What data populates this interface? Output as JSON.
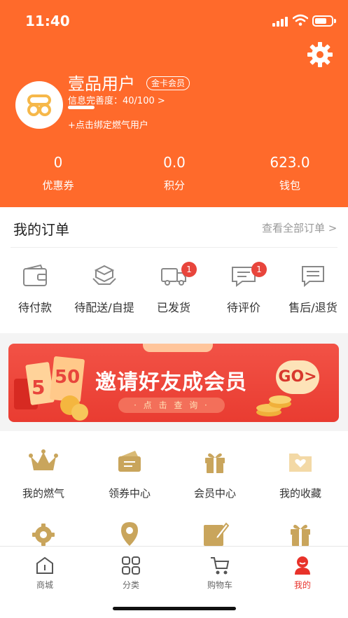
{
  "status_bar": {
    "time": "11:40"
  },
  "profile": {
    "name": "壹品用户",
    "badge": "金卡会员",
    "info_completeness": "信息完善度：40/100 >",
    "info_progress": 0.4,
    "bind_gas_link": "+点击绑定燃气用户"
  },
  "stats": [
    {
      "value": "0",
      "label": "优惠券"
    },
    {
      "value": "0.0",
      "label": "积分"
    },
    {
      "value": "623.0",
      "label": "钱包"
    }
  ],
  "orders": {
    "title": "我的订单",
    "view_all": "查看全部订单 >",
    "items": [
      {
        "label": "待付款",
        "icon": "wallet-icon",
        "badge": ""
      },
      {
        "label": "待配送/自提",
        "icon": "package-icon",
        "badge": ""
      },
      {
        "label": "已发货",
        "icon": "truck-icon",
        "badge": "1"
      },
      {
        "label": "待评价",
        "icon": "comment-icon",
        "badge": "1"
      },
      {
        "label": "售后/退货",
        "icon": "message-icon",
        "badge": ""
      }
    ]
  },
  "banner": {
    "title": "邀请好友成会员",
    "cta": "· 点 击 查 询 ·",
    "go": "GO>"
  },
  "features": [
    {
      "label": "我的燃气",
      "icon": "crown-icon"
    },
    {
      "label": "领券中心",
      "icon": "coupon-icon"
    },
    {
      "label": "会员中心",
      "icon": "gift-icon"
    },
    {
      "label": "我的收藏",
      "icon": "folder-heart-icon"
    },
    {
      "label": "",
      "icon": "gear-icon"
    },
    {
      "label": "",
      "icon": "location-pin-icon"
    },
    {
      "label": "",
      "icon": "edit-note-icon"
    },
    {
      "label": "",
      "icon": "gift-box-icon"
    }
  ],
  "tabbar": [
    {
      "label": "商城",
      "icon": "home-icon"
    },
    {
      "label": "分类",
      "icon": "grid-icon"
    },
    {
      "label": "购物车",
      "icon": "cart-icon"
    },
    {
      "label": "我的",
      "icon": "user-icon",
      "active": true
    }
  ],
  "colors": {
    "brand": "#ff6a2b",
    "badge_red": "#e8453c",
    "gold": "#c9a55c",
    "active_tab": "#e8322a"
  }
}
